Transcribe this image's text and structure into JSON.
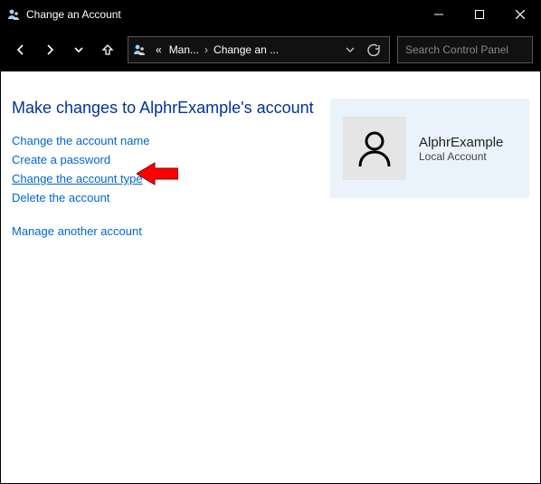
{
  "window": {
    "title": "Change an Account",
    "breadcrumb": {
      "prefix": "«",
      "seg1": "Man...",
      "seg2": "Change an ..."
    },
    "search_placeholder": "Search Control Panel"
  },
  "page": {
    "heading": "Make changes to AlphrExample's account",
    "links": {
      "change_name": "Change the account name",
      "create_pw": "Create a password",
      "change_type": "Change the account type",
      "delete": "Delete the account",
      "manage_other": "Manage another account"
    }
  },
  "account": {
    "name": "AlphrExample",
    "type": "Local Account"
  }
}
